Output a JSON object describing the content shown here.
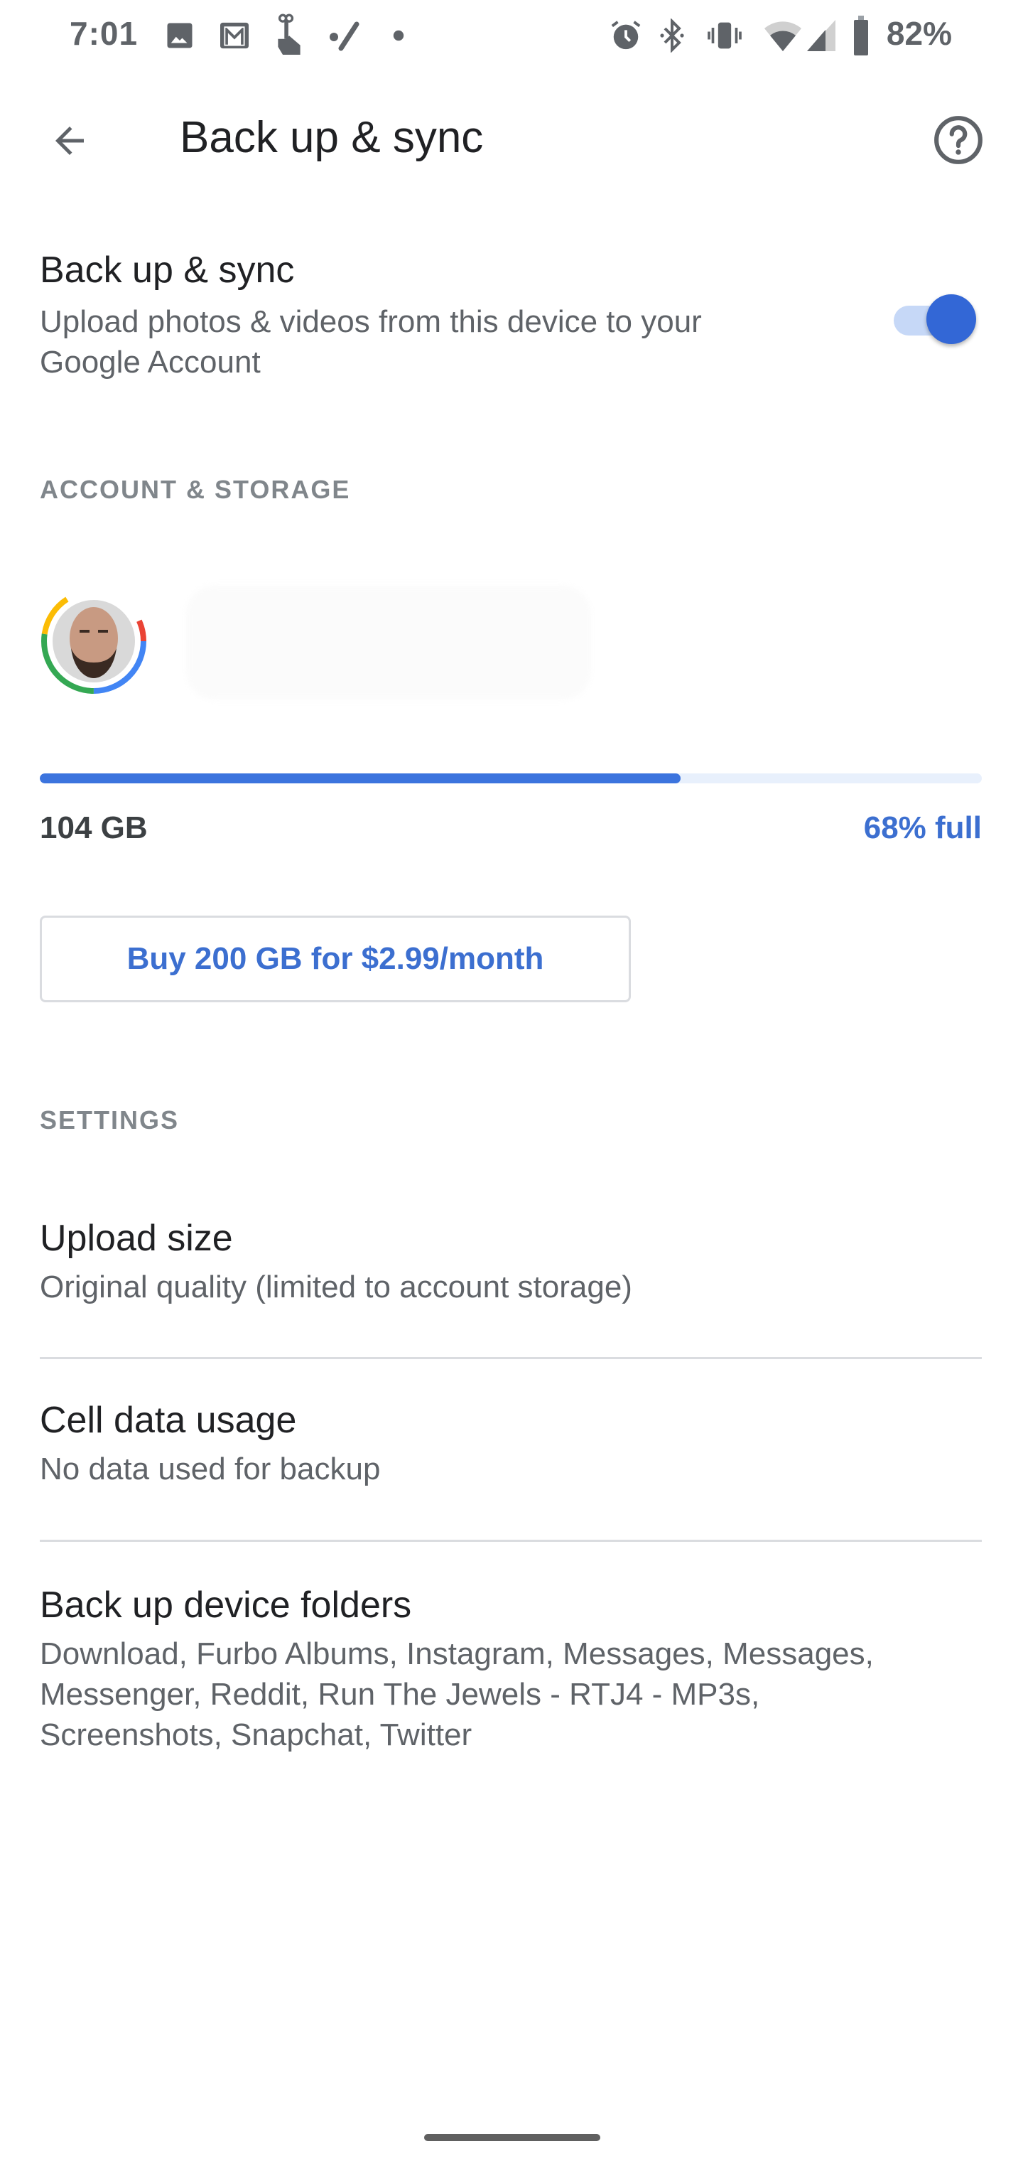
{
  "status_bar": {
    "time": "7:01",
    "left_icons": [
      "photos-notification-icon",
      "gmail-icon",
      "touch-gesture-icon",
      "edit-pen-icon",
      "more-dot-icon"
    ],
    "right_icons": [
      "alarm-icon",
      "bluetooth-icon",
      "vibrate-icon",
      "wifi-icon",
      "cell-signal-icon",
      "battery-icon"
    ],
    "battery_percent": "82%"
  },
  "header": {
    "back_icon": "arrow-back-icon",
    "title": "Back up & sync",
    "help_icon": "help-circle-icon"
  },
  "backup_toggle": {
    "title": "Back up & sync",
    "subtitle_line1": "Upload photos & videos from this device to your",
    "subtitle_line2": "Google Account",
    "enabled": true
  },
  "account_storage": {
    "section_label": "ACCOUNT & STORAGE",
    "account_name_redacted": true,
    "storage_used": "104 GB",
    "percent_full_label": "68% full",
    "percent_full_value": 0.68,
    "buy_button_label": "Buy 200 GB for $2.99/month"
  },
  "settings": {
    "section_label": "SETTINGS",
    "items": [
      {
        "title": "Upload size",
        "subtitle": "Original quality (limited to account storage)"
      },
      {
        "title": "Cell data usage",
        "subtitle": "No data used for backup"
      },
      {
        "title": "Back up device folders",
        "subtitle_lines": [
          "Download, Furbo Albums, Instagram, Messages, Messages,",
          "Messenger, Reddit, Run The Jewels - RTJ4 - MP3s,",
          "Screenshots, Snapchat, Twitter"
        ]
      }
    ]
  },
  "colors": {
    "accent": "#3c74de",
    "toggle_thumb": "#3367d6",
    "toggle_track": "#c6d8f7",
    "progress_track": "#e8f0fc",
    "link_text": "#3c6fd0",
    "divider": "#dadce0"
  }
}
